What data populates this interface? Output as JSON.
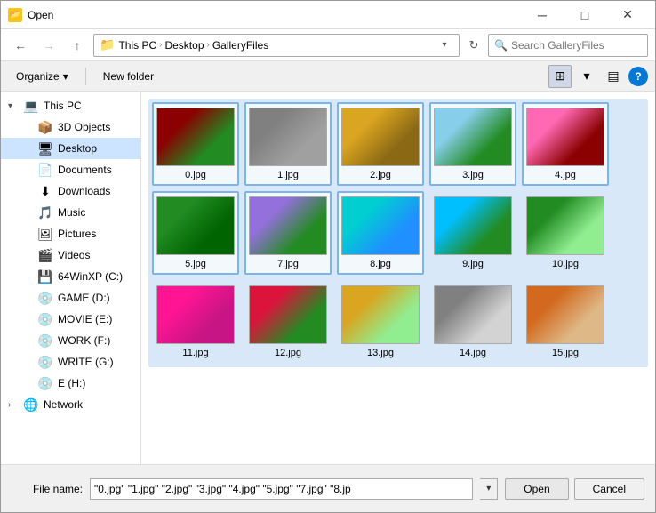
{
  "window": {
    "title": "Open",
    "close_label": "✕",
    "minimize_label": "─",
    "maximize_label": "□"
  },
  "nav": {
    "back_disabled": false,
    "forward_disabled": true,
    "up_disabled": false,
    "breadcrumb": [
      "This PC",
      "Desktop",
      "GalleryFiles"
    ],
    "search_placeholder": "Search GalleryFiles",
    "refresh_icon": "↻"
  },
  "toolbar": {
    "organize_label": "Organize",
    "organize_icon": "▾",
    "new_folder_label": "New folder",
    "view_icon_medium": "⊞",
    "view_icon_large": "▤",
    "help_label": "?"
  },
  "sidebar": {
    "items": [
      {
        "id": "this-pc",
        "label": "This PC",
        "icon": "💻",
        "indent": 0,
        "expandable": true,
        "expanded": true
      },
      {
        "id": "3d-objects",
        "label": "3D Objects",
        "icon": "📦",
        "indent": 1,
        "expandable": false
      },
      {
        "id": "desktop",
        "label": "Desktop",
        "icon": "🖥",
        "indent": 1,
        "expandable": false,
        "selected": true
      },
      {
        "id": "documents",
        "label": "Documents",
        "icon": "📄",
        "indent": 1,
        "expandable": false
      },
      {
        "id": "downloads",
        "label": "Downloads",
        "icon": "⬇",
        "indent": 1,
        "expandable": false
      },
      {
        "id": "music",
        "label": "Music",
        "icon": "🎵",
        "indent": 1,
        "expandable": false
      },
      {
        "id": "pictures",
        "label": "Pictures",
        "icon": "🖼",
        "indent": 1,
        "expandable": false
      },
      {
        "id": "videos",
        "label": "Videos",
        "icon": "🎬",
        "indent": 1,
        "expandable": false
      },
      {
        "id": "64winxp",
        "label": "64WinXP (C:)",
        "icon": "💾",
        "indent": 1,
        "expandable": false
      },
      {
        "id": "game-d",
        "label": "GAME (D:)",
        "icon": "💿",
        "indent": 1,
        "expandable": false
      },
      {
        "id": "movie-e",
        "label": "MOVIE (E:)",
        "icon": "💿",
        "indent": 1,
        "expandable": false
      },
      {
        "id": "work-f",
        "label": "WORK (F:)",
        "icon": "💿",
        "indent": 1,
        "expandable": false
      },
      {
        "id": "write-g",
        "label": "WRITE (G:)",
        "icon": "💿",
        "indent": 1,
        "expandable": false
      },
      {
        "id": "e-h",
        "label": "E (H:)",
        "icon": "💿",
        "indent": 1,
        "expandable": false
      },
      {
        "id": "network",
        "label": "Network",
        "icon": "🌐",
        "indent": 0,
        "expandable": true
      }
    ]
  },
  "files": [
    {
      "name": "0.jpg",
      "thumb": "thumb-0",
      "selected": true
    },
    {
      "name": "1.jpg",
      "thumb": "thumb-1",
      "selected": true
    },
    {
      "name": "2.jpg",
      "thumb": "thumb-2",
      "selected": true
    },
    {
      "name": "3.jpg",
      "thumb": "thumb-3",
      "selected": true
    },
    {
      "name": "4.jpg",
      "thumb": "thumb-4",
      "selected": true
    },
    {
      "name": "5.jpg",
      "thumb": "thumb-5",
      "selected": true
    },
    {
      "name": "7.jpg",
      "thumb": "thumb-7",
      "selected": true
    },
    {
      "name": "8.jpg",
      "thumb": "thumb-8",
      "selected": true
    },
    {
      "name": "9.jpg",
      "thumb": "thumb-9",
      "selected": false
    },
    {
      "name": "10.jpg",
      "thumb": "thumb-10",
      "selected": false
    },
    {
      "name": "11.jpg",
      "thumb": "thumb-11",
      "selected": false
    },
    {
      "name": "12.jpg",
      "thumb": "thumb-12",
      "selected": false
    },
    {
      "name": "13.jpg",
      "thumb": "thumb-13",
      "selected": false
    },
    {
      "name": "14.jpg",
      "thumb": "thumb-14",
      "selected": false
    },
    {
      "name": "15.jpg",
      "thumb": "thumb-15",
      "selected": false
    }
  ],
  "bottom": {
    "filename_label": "File name:",
    "filename_value": "\"0.jpg\" \"1.jpg\" \"2.jpg\" \"3.jpg\" \"4.jpg\" \"5.jpg\" \"7.jpg\" \"8.jp",
    "open_label": "Open",
    "cancel_label": "Cancel"
  }
}
